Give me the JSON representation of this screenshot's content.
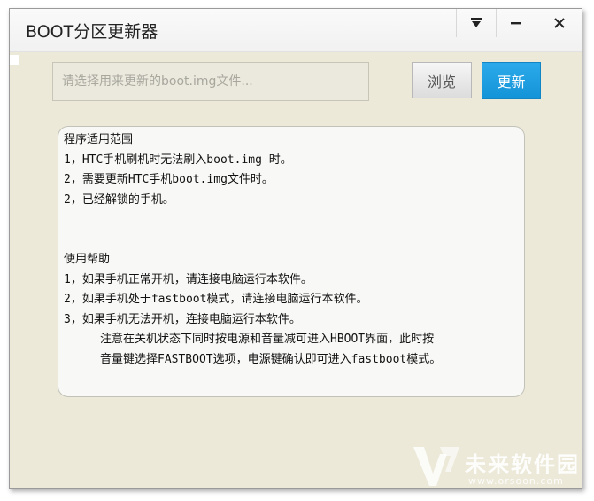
{
  "window": {
    "title": "BOOT分区更新器"
  },
  "titlebar_buttons": {
    "menu": "dropdown-menu-icon",
    "minimize": "minimize-icon",
    "close": "close-icon"
  },
  "file_select": {
    "placeholder": "请选择用来更新的boot.img文件...",
    "value": "",
    "browse_label": "浏览",
    "update_label": "更新"
  },
  "help": {
    "lines": [
      "程序适用范围",
      "1，HTC手机刷机时无法刷入boot.img 时。",
      "2，需要更新HTC手机boot.img文件时。",
      "2，已经解锁的手机。",
      "",
      "",
      "使用帮助",
      "1，如果手机正常开机，请连接电脑运行本软件。",
      "2，如果手机处于fastboot模式，请连接电脑运行本软件。",
      "3，如果手机无法开机，连接电脑运行本软件。",
      "注意在关机状态下同时按电源和音量减可进入HBOOT界面，此时按",
      "音量键选择FASTBOOT选项，电源键确认即可进入fastboot模式。"
    ]
  },
  "watermark": {
    "name": "未来软件园",
    "url": "www.orsoon.com"
  },
  "colors": {
    "window_bg": "#ece9d9",
    "accent": "#1e9fe2",
    "box_bg": "#f8f8f6"
  }
}
